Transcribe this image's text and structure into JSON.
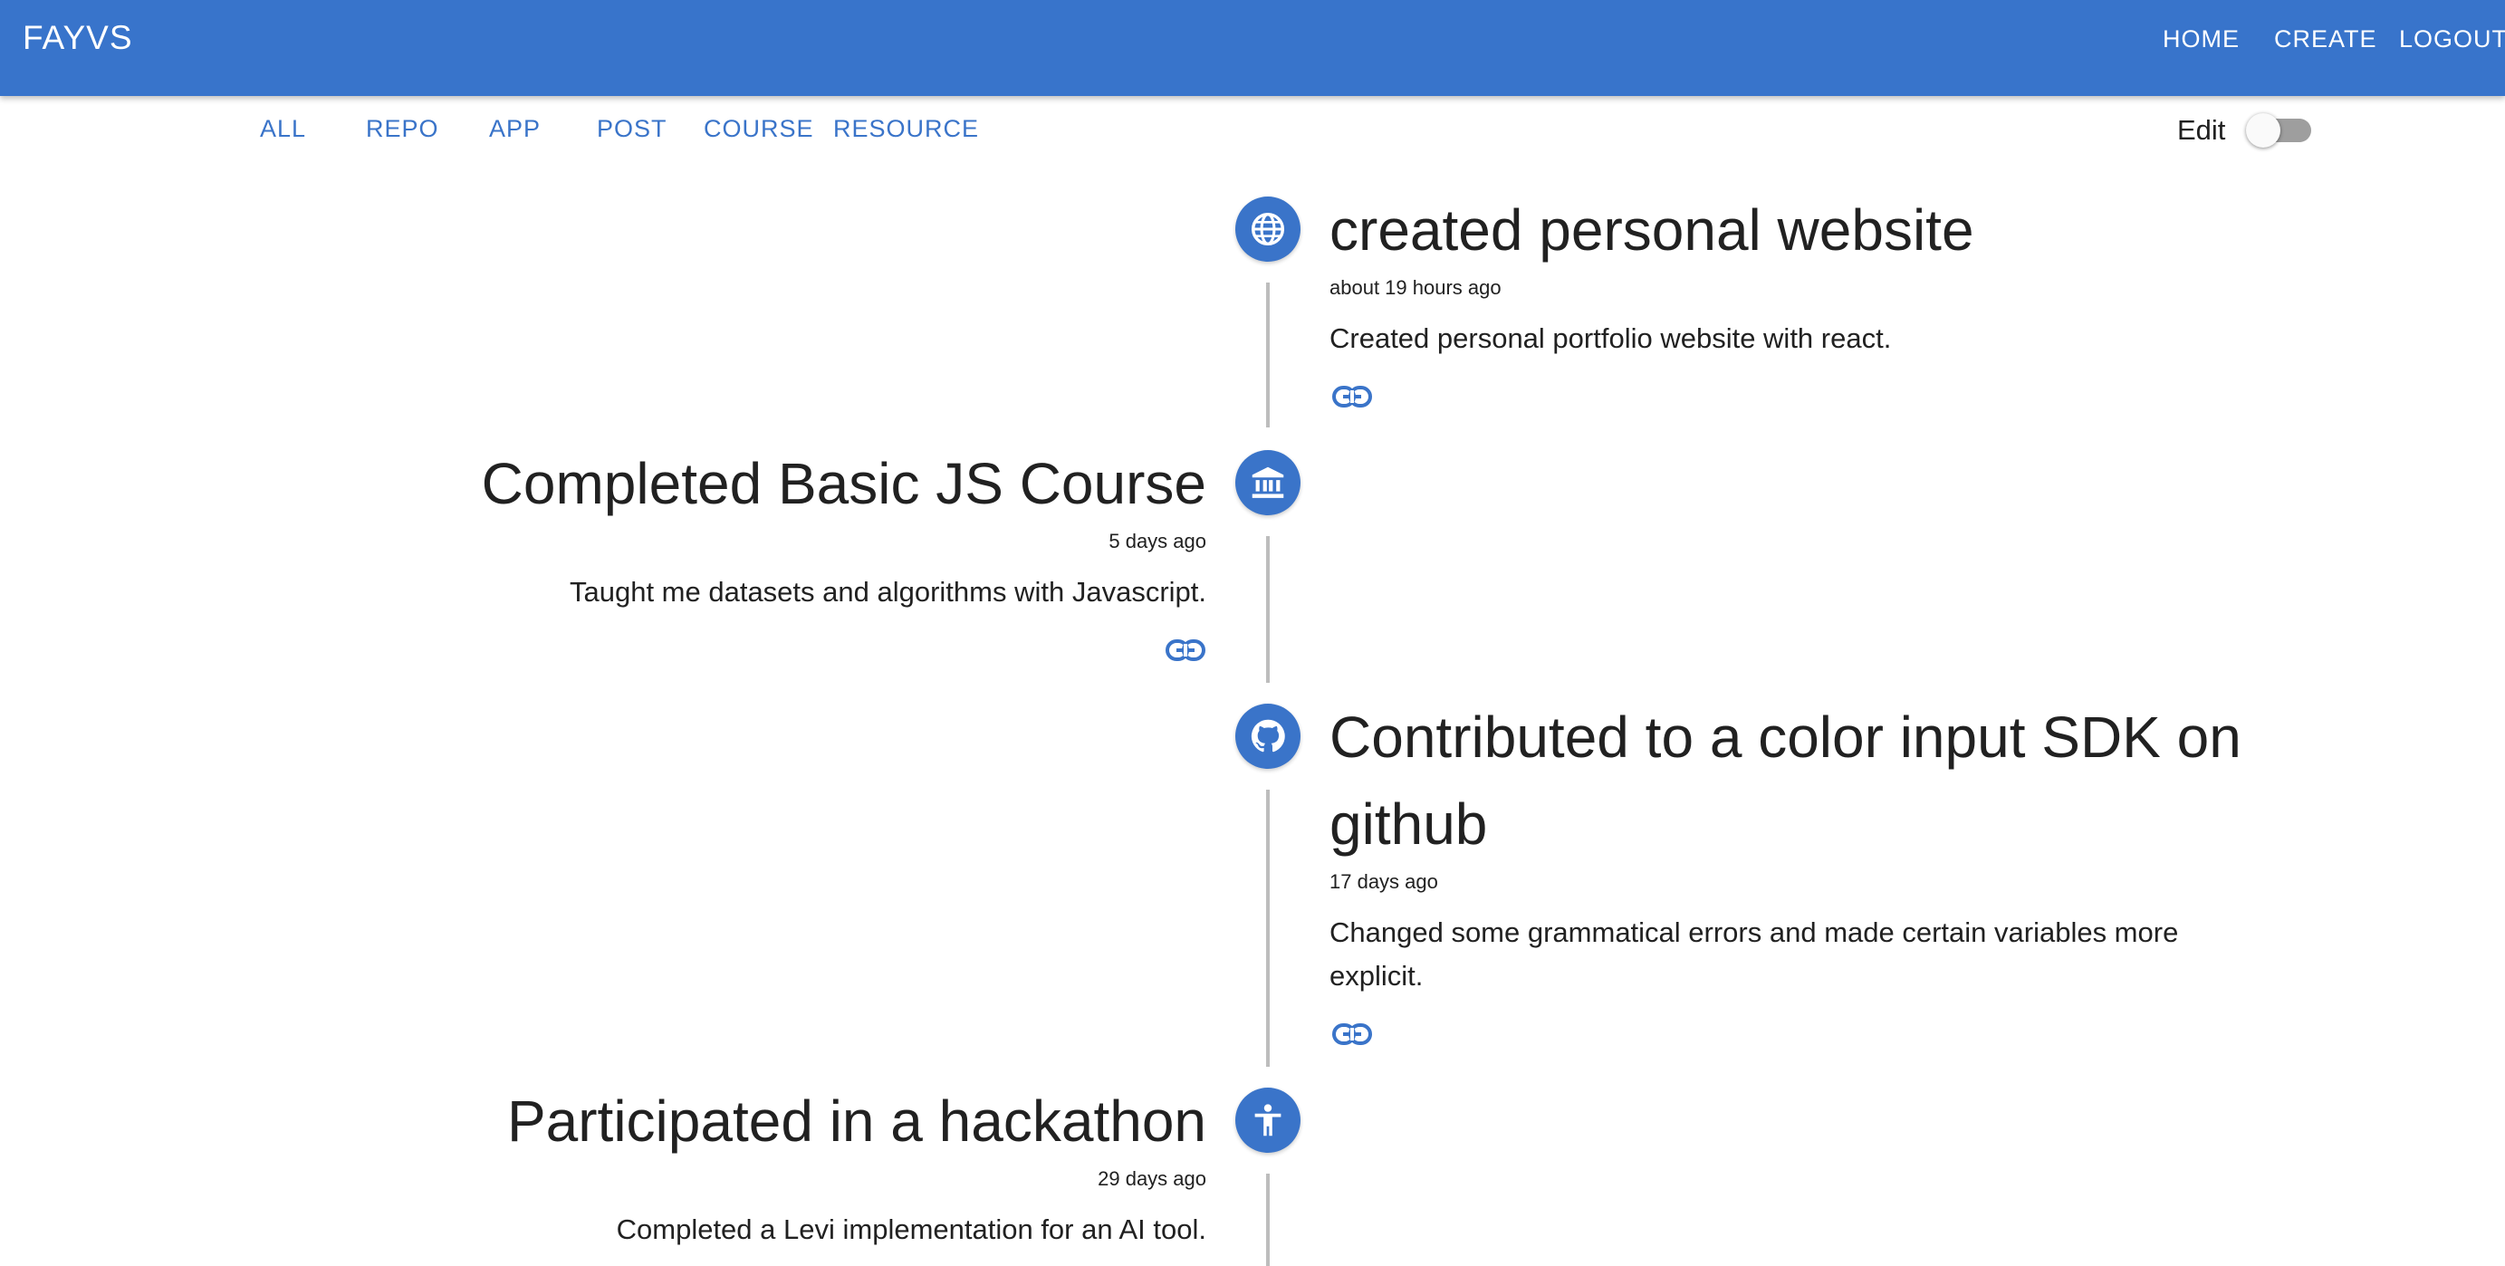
{
  "appbar": {
    "brand": "FAYVS",
    "nav": {
      "home": "HOME",
      "create": "CREATE",
      "logout": "LOGOUT"
    },
    "color": "#3874cb"
  },
  "filters": [
    "ALL",
    "REPO",
    "APP",
    "POST",
    "COURSE",
    "RESOURCE"
  ],
  "edit_toggle": {
    "label": "Edit",
    "checked": false
  },
  "timeline": [
    {
      "icon": "globe-icon",
      "title": "created personal website",
      "time": "about 19 hours ago",
      "description": "Created personal portfolio website with react.",
      "side": "right"
    },
    {
      "icon": "bank-icon",
      "title": "Completed Basic JS Course",
      "time": "5 days ago",
      "description": "Taught me datasets and algorithms with Javascript.",
      "side": "left"
    },
    {
      "icon": "github-icon",
      "title": "Contributed to a color input SDK on github",
      "time": "17 days ago",
      "description": "Changed some grammatical errors and made certain variables more explicit.",
      "side": "right"
    },
    {
      "icon": "accessibility-icon",
      "title": "Participated in a hackathon",
      "time": "29 days ago",
      "description": "Completed a Levi implementation for an AI tool.",
      "side": "left"
    }
  ],
  "accent_color": "#3a74c9"
}
